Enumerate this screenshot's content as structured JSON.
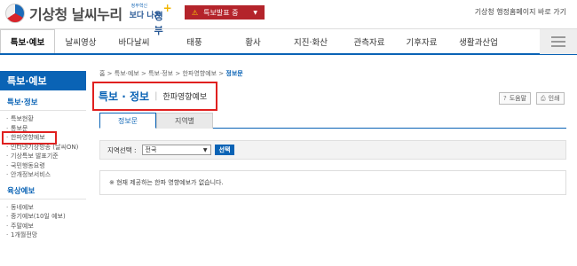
{
  "header": {
    "site_name": "기상청 날씨누리",
    "badge_small": "정부혁신",
    "badge_word1": "보다 나은",
    "badge_word2": "정부",
    "alert_label": "특보발표 중",
    "gov_link": "기상청 행정홈페이지 바로 가기"
  },
  "nav": {
    "items": [
      "특보·예보",
      "날씨영상",
      "바다날씨",
      "태풍",
      "황사",
      "지진·화산",
      "관측자료",
      "기후자료",
      "생활과산업"
    ]
  },
  "sidebar": {
    "title": "특보·예보",
    "section1": "특보·정보",
    "section1_items": [
      "특보현황",
      "통보문",
      "한파영향예보",
      "인터넷기상방송 (날씨ON)",
      "기상특보 발표기준",
      "국민행동요령",
      "안개정보서비스"
    ],
    "section2": "육상예보",
    "section2_items": [
      "동네예보",
      "중기예보(10일 예보)",
      "주말예보",
      "1개월전망"
    ]
  },
  "breadcrumb": {
    "home": "홈",
    "path": [
      "특보·예보",
      "특보·정보",
      "한파영향예보"
    ],
    "current": "정보문"
  },
  "page": {
    "title": "특보 · 정보",
    "subtitle": "한파영향예보",
    "help_label": "도움말",
    "print_label": "인쇄"
  },
  "tabs": [
    "정보문",
    "지역별"
  ],
  "filter": {
    "label": "지역선택 :",
    "selected": "전국",
    "button": "선택"
  },
  "notice": "※ 현재 제공하는 한파 영향예보가 없습니다."
}
